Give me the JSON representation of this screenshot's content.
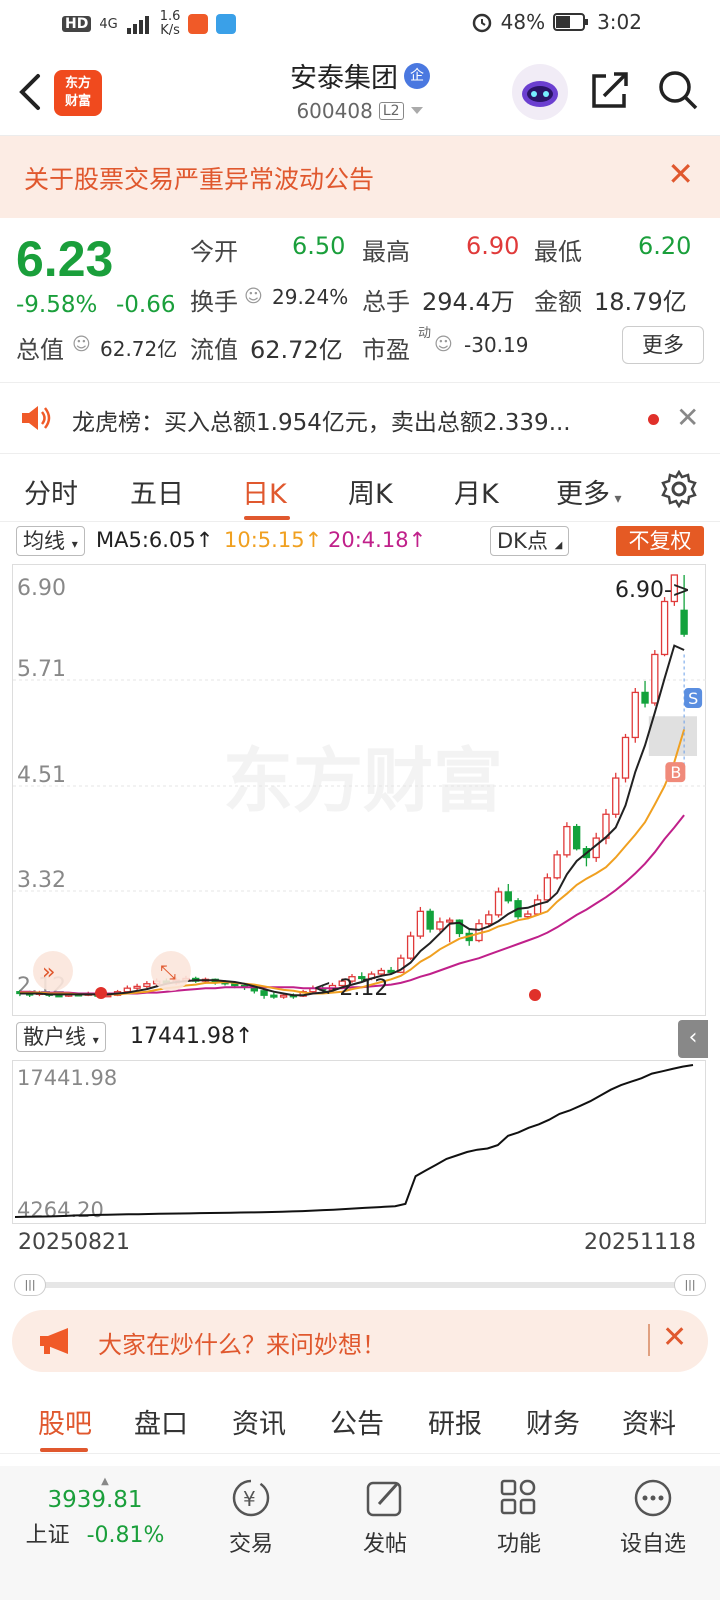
{
  "status_bar": {
    "net": "4G",
    "speed_value": "1.6",
    "speed_unit": "K/s",
    "battery": "48%",
    "time": "3:02"
  },
  "header": {
    "logo_text_1": "东方",
    "logo_text_2": "财富",
    "stock_name": "安泰集团",
    "qi_badge": "企",
    "stock_code": "600408",
    "level": "L2"
  },
  "notice": {
    "text": "关于股票交易严重异常波动公告"
  },
  "quote": {
    "price": "6.23",
    "change_pct": "-9.58%",
    "change_amt": "-0.66",
    "open_label": "今开",
    "open": "6.50",
    "high_label": "最高",
    "high": "6.90",
    "low_label": "最低",
    "low": "6.20",
    "turnover_label": "换手",
    "turnover": "29.24%",
    "volume_label": "总手",
    "volume": "294.4万",
    "amount_label": "金额",
    "amount": "18.79亿",
    "mcap_label": "总值",
    "mcap": "62.72亿",
    "float_label": "流值",
    "float_cap": "62.72亿",
    "pe_label": "市盈",
    "pe_sup": "动",
    "pe": "-30.19",
    "more": "更多"
  },
  "dragon_tiger": {
    "text": "龙虎榜：买入总额1.954亿元，卖出总额2.339..."
  },
  "period_tabs": [
    "分时",
    "五日",
    "日K",
    "周K",
    "月K",
    "更多"
  ],
  "ma_bar": {
    "ma_type": "均线",
    "ma5": "MA5:6.05",
    "ma10": "10:5.15",
    "ma20": "20:4.18",
    "dk": "DK点",
    "adjust": "不复权",
    "ma5_color": "#222222",
    "ma10_color": "#f0a020",
    "ma20_color": "#c0208a"
  },
  "chart_data": [
    {
      "type": "candlestick",
      "y_ticks": [
        "6.90",
        "5.71",
        "4.51",
        "3.32",
        "2.12"
      ],
      "ylim": [
        2.12,
        6.9
      ],
      "max_label": "6.90->",
      "min_label": "2.12",
      "markers": {
        "sell": "S",
        "buy": "B"
      },
      "candles": [
        [
          2.18,
          2.16,
          2.2,
          2.13
        ],
        [
          2.16,
          2.15,
          2.19,
          2.12
        ],
        [
          2.15,
          2.17,
          2.19,
          2.13
        ],
        [
          2.17,
          2.14,
          2.18,
          2.12
        ],
        [
          2.14,
          2.13,
          2.16,
          2.12
        ],
        [
          2.13,
          2.15,
          2.17,
          2.12
        ],
        [
          2.15,
          2.14,
          2.17,
          2.13
        ],
        [
          2.14,
          2.16,
          2.18,
          2.13
        ],
        [
          2.16,
          2.13,
          2.17,
          2.12
        ],
        [
          2.13,
          2.14,
          2.16,
          2.12
        ],
        [
          2.14,
          2.18,
          2.2,
          2.13
        ],
        [
          2.18,
          2.22,
          2.25,
          2.17
        ],
        [
          2.22,
          2.24,
          2.27,
          2.2
        ],
        [
          2.24,
          2.27,
          2.3,
          2.22
        ],
        [
          2.27,
          2.3,
          2.33,
          2.25
        ],
        [
          2.3,
          2.28,
          2.33,
          2.26
        ],
        [
          2.28,
          2.31,
          2.34,
          2.26
        ],
        [
          2.31,
          2.33,
          2.36,
          2.29
        ],
        [
          2.33,
          2.3,
          2.35,
          2.28
        ],
        [
          2.3,
          2.32,
          2.34,
          2.27
        ],
        [
          2.32,
          2.29,
          2.33,
          2.26
        ],
        [
          2.29,
          2.27,
          2.31,
          2.25
        ],
        [
          2.27,
          2.25,
          2.29,
          2.22
        ],
        [
          2.25,
          2.23,
          2.27,
          2.2
        ],
        [
          2.23,
          2.19,
          2.25,
          2.16
        ],
        [
          2.19,
          2.14,
          2.21,
          2.1
        ],
        [
          2.14,
          2.12,
          2.17,
          2.1
        ],
        [
          2.12,
          2.14,
          2.16,
          2.1
        ],
        [
          2.14,
          2.13,
          2.16,
          2.1
        ],
        [
          2.13,
          2.18,
          2.2,
          2.12
        ],
        [
          2.18,
          2.22,
          2.25,
          2.16
        ],
        [
          2.22,
          2.2,
          2.26,
          2.18
        ],
        [
          2.2,
          2.25,
          2.28,
          2.19
        ],
        [
          2.25,
          2.3,
          2.33,
          2.23
        ],
        [
          2.3,
          2.35,
          2.38,
          2.28
        ],
        [
          2.35,
          2.33,
          2.4,
          2.3
        ],
        [
          2.33,
          2.38,
          2.41,
          2.31
        ],
        [
          2.38,
          2.42,
          2.45,
          2.35
        ],
        [
          2.42,
          2.4,
          2.46,
          2.38
        ],
        [
          2.4,
          2.56,
          2.6,
          2.39
        ],
        [
          2.56,
          2.81,
          2.86,
          2.54
        ],
        [
          2.81,
          3.09,
          3.14,
          2.78
        ],
        [
          3.09,
          2.89,
          3.12,
          2.85
        ],
        [
          2.89,
          2.97,
          3.02,
          2.86
        ],
        [
          2.97,
          2.99,
          3.02,
          2.74
        ],
        [
          2.99,
          2.84,
          3.0,
          2.8
        ],
        [
          2.84,
          2.76,
          2.9,
          2.7
        ],
        [
          2.76,
          2.95,
          3.0,
          2.74
        ],
        [
          2.95,
          3.05,
          3.1,
          2.92
        ],
        [
          3.05,
          3.31,
          3.36,
          3.02
        ],
        [
          3.31,
          3.21,
          3.4,
          3.18
        ],
        [
          3.21,
          3.03,
          3.24,
          3.0
        ],
        [
          3.03,
          3.06,
          3.1,
          3.0
        ],
        [
          3.06,
          3.22,
          3.28,
          3.04
        ],
        [
          3.22,
          3.47,
          3.52,
          3.2
        ],
        [
          3.47,
          3.73,
          3.78,
          3.45
        ],
        [
          3.73,
          4.05,
          4.1,
          3.7
        ],
        [
          4.05,
          3.8,
          4.08,
          3.78
        ],
        [
          3.8,
          3.7,
          3.83,
          3.6
        ],
        [
          3.7,
          3.92,
          3.98,
          3.65
        ],
        [
          3.92,
          4.19,
          4.25,
          3.85
        ],
        [
          4.19,
          4.6,
          4.66,
          4.15
        ],
        [
          4.6,
          5.06,
          5.1,
          4.55
        ],
        [
          5.06,
          5.57,
          5.62,
          5.0
        ],
        [
          5.57,
          5.45,
          5.7,
          5.4
        ],
        [
          5.45,
          6.0,
          6.05,
          5.42
        ],
        [
          6.0,
          6.6,
          6.65,
          5.98
        ],
        [
          6.6,
          6.9,
          6.9,
          6.55
        ],
        [
          6.5,
          6.23,
          6.9,
          6.2
        ]
      ],
      "ma5": [
        2.16,
        2.16,
        2.16,
        2.15,
        2.15,
        2.15,
        2.15,
        2.15,
        2.15,
        2.15,
        2.16,
        2.17,
        2.19,
        2.21,
        2.24,
        2.27,
        2.29,
        2.3,
        2.31,
        2.31,
        2.31,
        2.3,
        2.29,
        2.27,
        2.24,
        2.21,
        2.18,
        2.16,
        2.14,
        2.14,
        2.16,
        2.17,
        2.19,
        2.23,
        2.26,
        2.29,
        2.33,
        2.36,
        2.38,
        2.43,
        2.51,
        2.64,
        2.73,
        2.84,
        2.95,
        2.96,
        2.89,
        2.88,
        2.92,
        2.98,
        3.06,
        3.12,
        3.13,
        3.17,
        3.2,
        3.3,
        3.51,
        3.66,
        3.75,
        3.84,
        3.93,
        4.04,
        4.29,
        4.67,
        4.97,
        5.34,
        5.73,
        6.1,
        6.05
      ],
      "ma10": [
        2.17,
        2.17,
        2.17,
        2.16,
        2.16,
        2.16,
        2.15,
        2.15,
        2.15,
        2.15,
        2.15,
        2.16,
        2.17,
        2.18,
        2.2,
        2.22,
        2.23,
        2.25,
        2.26,
        2.28,
        2.28,
        2.29,
        2.28,
        2.27,
        2.26,
        2.24,
        2.22,
        2.2,
        2.19,
        2.17,
        2.16,
        2.16,
        2.17,
        2.18,
        2.21,
        2.23,
        2.26,
        2.29,
        2.32,
        2.36,
        2.43,
        2.52,
        2.58,
        2.66,
        2.72,
        2.78,
        2.81,
        2.84,
        2.87,
        2.92,
        2.95,
        2.99,
        3.01,
        3.05,
        3.09,
        3.2,
        3.29,
        3.39,
        3.46,
        3.52,
        3.59,
        3.7,
        3.83,
        3.96,
        4.1,
        4.3,
        4.51,
        4.78,
        5.15
      ],
      "ma20": [
        2.18,
        2.18,
        2.17,
        2.17,
        2.17,
        2.17,
        2.16,
        2.16,
        2.16,
        2.16,
        2.16,
        2.16,
        2.16,
        2.17,
        2.17,
        2.18,
        2.19,
        2.2,
        2.21,
        2.22,
        2.22,
        2.23,
        2.23,
        2.23,
        2.23,
        2.23,
        2.23,
        2.23,
        2.23,
        2.22,
        2.22,
        2.22,
        2.22,
        2.22,
        2.23,
        2.23,
        2.24,
        2.25,
        2.26,
        2.28,
        2.31,
        2.35,
        2.38,
        2.42,
        2.46,
        2.5,
        2.53,
        2.56,
        2.6,
        2.64,
        2.68,
        2.72,
        2.76,
        2.8,
        2.85,
        2.91,
        2.98,
        3.05,
        3.11,
        3.18,
        3.25,
        3.33,
        3.42,
        3.52,
        3.63,
        3.76,
        3.91,
        4.04,
        4.18
      ]
    },
    {
      "type": "line",
      "name": "散户线",
      "y_ticks": [
        "17441.98",
        "4264.20"
      ],
      "ylim": [
        4264.2,
        17441.98
      ],
      "values": [
        4264.2,
        4280,
        4300,
        4310,
        4330,
        4360,
        4400,
        4420,
        4450,
        4460,
        4480,
        4500,
        4510,
        4520,
        4540,
        4560,
        4570,
        4580,
        4600,
        4610,
        4620,
        4640,
        4650,
        4660,
        4680,
        4700,
        4720,
        4750,
        4780,
        4820,
        4860,
        4900,
        4950,
        5000,
        5050,
        5100,
        5150,
        5200,
        5400,
        7800,
        8300,
        8800,
        9300,
        9600,
        9900,
        10100,
        10200,
        10500,
        11300,
        11600,
        12000,
        12300,
        12700,
        13200,
        13500,
        13900,
        14300,
        14800,
        15300,
        15700,
        16000,
        16300,
        16700,
        16900,
        17100,
        17300,
        17441.98
      ],
      "x_start": "20250821",
      "x_end": "20251118"
    }
  ],
  "sub_bar": {
    "indicator": "散户线",
    "value": "17441.98↑"
  },
  "ask_bar": {
    "text": "大家在炒什么？来问妙想！"
  },
  "bottom_tabs": [
    "股吧",
    "盘口",
    "资讯",
    "公告",
    "研报",
    "财务",
    "资料"
  ],
  "nav": {
    "index_value": "3939.81",
    "index_name": "上证",
    "index_change": "-0.81%",
    "trade": "交易",
    "post": "发帖",
    "functions": "功能",
    "watchlist": "设自选"
  }
}
